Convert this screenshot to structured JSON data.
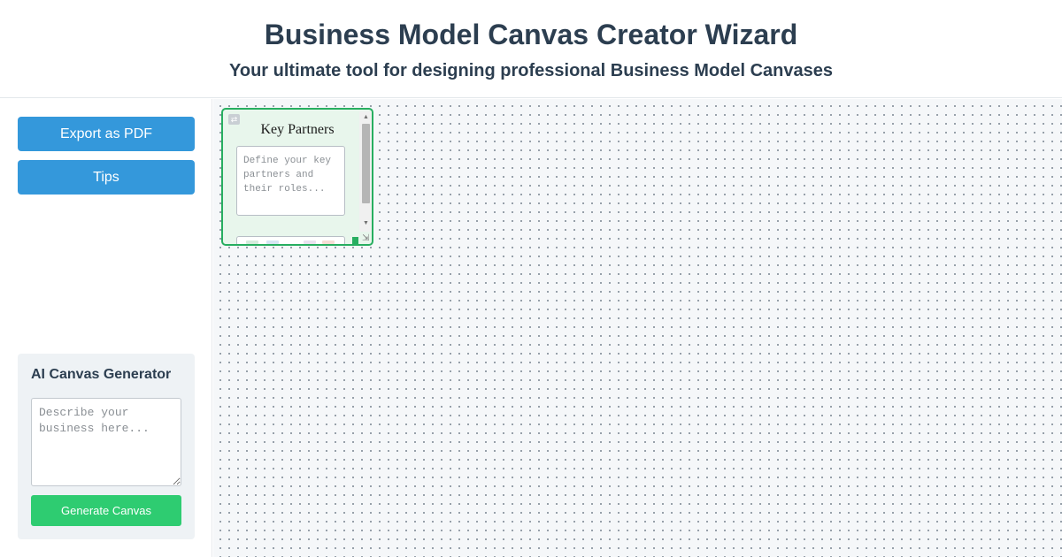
{
  "header": {
    "title": "Business Model Canvas Creator Wizard",
    "subtitle": "Your ultimate tool for designing professional Business Model Canvases"
  },
  "sidebar": {
    "export_label": "Export as PDF",
    "tips_label": "Tips",
    "ai": {
      "title": "AI Canvas Generator",
      "placeholder": "Describe your business here...",
      "value": "",
      "generate_label": "Generate Canvas"
    }
  },
  "canvas": {
    "blocks": [
      {
        "title": "Key Partners",
        "placeholder": "Define your key partners and their roles...",
        "value": "",
        "border_color": "#27ae60",
        "background": "#e8f6ec"
      }
    ]
  },
  "colors": {
    "primary": "#3498db",
    "success": "#2ecc71",
    "heading": "#2c3e50"
  },
  "icons": {
    "drag": "drag-handle-icon",
    "resize": "resize-grip-icon"
  }
}
